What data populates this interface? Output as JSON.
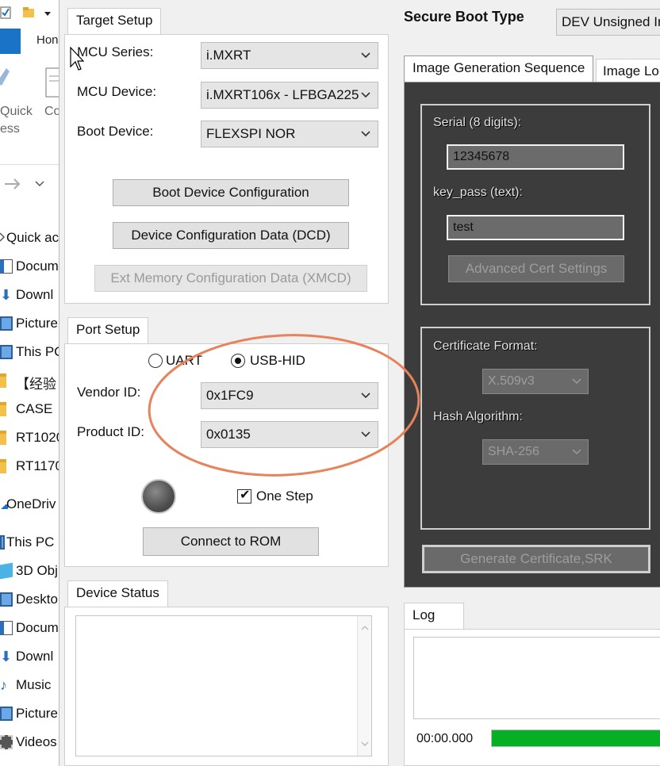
{
  "explorer": {
    "home_tab": "Hon",
    "ribbon_quick_access": "Quick",
    "ribbon_quick_access_2": "ess",
    "ribbon_copy": "Co",
    "tree": [
      {
        "label": "Quick ac",
        "icon": "star-icon"
      },
      {
        "label": "Docum",
        "icon": "document-icon"
      },
      {
        "label": "Downl",
        "icon": "download-icon"
      },
      {
        "label": "Picture",
        "icon": "picture-icon"
      },
      {
        "label": "This PC",
        "icon": "pc-icon"
      },
      {
        "label": "【经验",
        "icon": "folder-icon"
      },
      {
        "label": "CASE",
        "icon": "folder-icon"
      },
      {
        "label": "RT1020",
        "icon": "folder-icon"
      },
      {
        "label": "RT1170",
        "icon": "folder-icon"
      },
      {
        "label": "OneDriv",
        "icon": "cloud-icon"
      },
      {
        "label": "This PC",
        "icon": "pc-icon"
      },
      {
        "label": "3D Obj",
        "icon": "cube-icon"
      },
      {
        "label": "Deskto",
        "icon": "desktop-icon"
      },
      {
        "label": "Docum",
        "icon": "document-icon"
      },
      {
        "label": "Downl",
        "icon": "download-icon"
      },
      {
        "label": "Music",
        "icon": "music-icon"
      },
      {
        "label": "Picture",
        "icon": "picture-icon"
      },
      {
        "label": "Videos",
        "icon": "video-icon"
      }
    ]
  },
  "target_setup": {
    "tab": "Target Setup",
    "mcu_series_label": "MCU Series:",
    "mcu_series_value": "i.MXRT",
    "mcu_device_label": "MCU Device:",
    "mcu_device_value": "i.MXRT106x - LFBGA225",
    "boot_device_label": "Boot Device:",
    "boot_device_value": "FLEXSPI NOR",
    "boot_device_config_btn": "Boot Device Configuration",
    "dcd_btn": "Device Configuration Data (DCD)",
    "xmcd_btn": "Ext Memory Configuration Data (XMCD)"
  },
  "port_setup": {
    "tab": "Port Setup",
    "uart_label": "UART",
    "usbhid_label": "USB-HID",
    "selected": "USB-HID",
    "vendor_id_label": "Vendor ID:",
    "vendor_id_value": "0x1FC9",
    "product_id_label": "Product ID:",
    "product_id_value": "0x0135",
    "one_step_label": "One Step",
    "one_step_checked": true,
    "connect_btn": "Connect to ROM"
  },
  "device_status": {
    "tab": "Device Status"
  },
  "secure_boot": {
    "label": "Secure Boot Type",
    "value": "DEV Unsigned Ir"
  },
  "image_tabs": {
    "active": "Image Generation Sequence",
    "second": "Image Lo"
  },
  "image_gen": {
    "serial_label": "Serial (8 digits):",
    "serial_value": "12345678",
    "keypass_label": "key_pass (text):",
    "keypass_value": "test",
    "adv_cert_btn": "Advanced Cert Settings",
    "cert_format_label": "Certificate Format:",
    "cert_format_value": "X.509v3",
    "hash_label": "Hash Algorithm:",
    "hash_value": "SHA-256",
    "gen_btn": "Generate Certificate,SRK"
  },
  "log": {
    "tab": "Log",
    "timer": "00:00.000",
    "progress_fraction": 1.0
  },
  "colors": {
    "annotation": "#e8825a",
    "progress": "#06b025",
    "dark_panel": "#3c3c3c"
  }
}
